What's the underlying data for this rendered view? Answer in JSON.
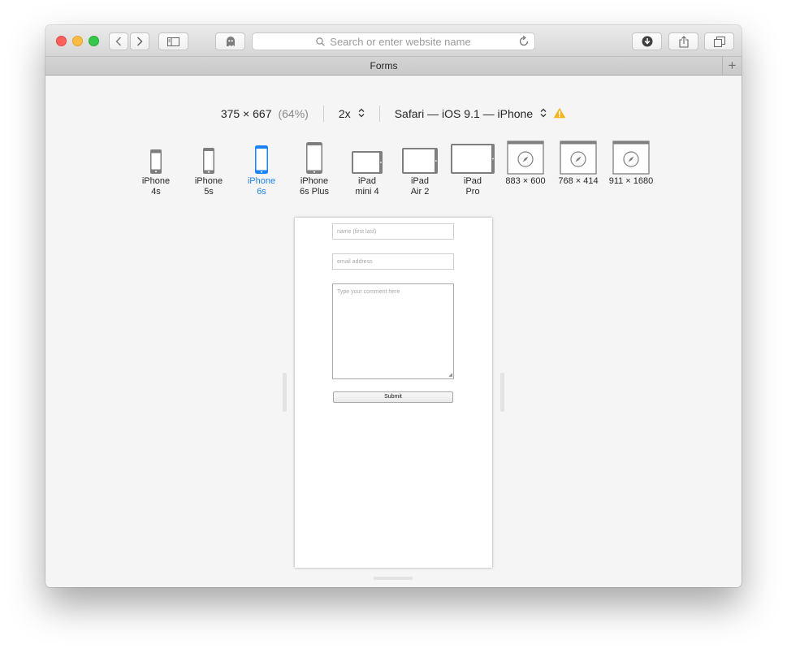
{
  "window": {
    "address_placeholder": "Search or enter website name",
    "tab_title": "Forms",
    "new_tab": "+"
  },
  "rdm": {
    "resolution": "375 × 667",
    "scale": "(64%)",
    "pixel_ratio": "2x",
    "user_agent": "Safari — iOS 9.1 — iPhone",
    "chevron": "⌃⌄"
  },
  "devices": [
    {
      "line1": "iPhone",
      "line2": "4s",
      "active": false,
      "icon": "iphone-icon"
    },
    {
      "line1": "iPhone",
      "line2": "5s",
      "active": false,
      "icon": "iphone-icon"
    },
    {
      "line1": "iPhone",
      "line2": "6s",
      "active": true,
      "icon": "iphone-icon"
    },
    {
      "line1": "iPhone",
      "line2": "6s Plus",
      "active": false,
      "icon": "iphone-icon"
    },
    {
      "line1": "iPad",
      "line2": "mini 4",
      "active": false,
      "icon": "ipad-icon"
    },
    {
      "line1": "iPad",
      "line2": "Air 2",
      "active": false,
      "icon": "ipad-icon"
    },
    {
      "line1": "iPad",
      "line2": "Pro",
      "active": false,
      "icon": "ipad-icon"
    },
    {
      "line1": "883 × 600",
      "line2": "",
      "active": false,
      "icon": "safari-window-icon"
    },
    {
      "line1": "768 × 414",
      "line2": "",
      "active": false,
      "icon": "safari-window-icon"
    },
    {
      "line1": "911 × 1680",
      "line2": "",
      "active": false,
      "icon": "safari-window-icon"
    }
  ],
  "form": {
    "name_placeholder": "name (first last)",
    "email_placeholder": "email address",
    "comment_placeholder": "Type your comment here",
    "submit_label": "Submit"
  },
  "colors": {
    "accent": "#1a82fb",
    "warning": "#f2b51b"
  }
}
